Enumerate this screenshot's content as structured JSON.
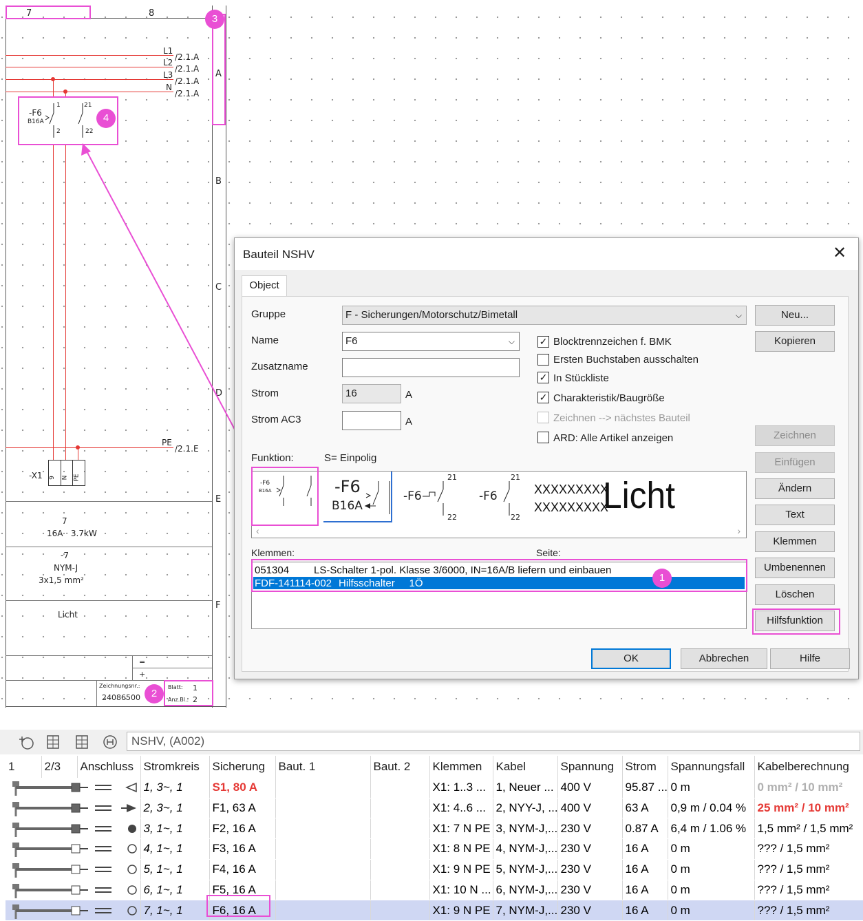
{
  "schematic": {
    "col_numbers": [
      "7",
      "8"
    ],
    "row_letters": [
      "A",
      "B",
      "C",
      "D",
      "E",
      "F"
    ],
    "phases": [
      {
        "name": "L1",
        "ref": "/2.1.A"
      },
      {
        "name": "L2",
        "ref": "/2.1.A"
      },
      {
        "name": "L3",
        "ref": "/2.1.A"
      },
      {
        "name": "N",
        "ref": "/2.1.A"
      }
    ],
    "pe": {
      "name": "PE",
      "ref": "/2.1.E"
    },
    "component": {
      "tag": "-F6",
      "rating": "B16A",
      "pins": [
        "1",
        "2"
      ],
      "aux_pins": [
        "21",
        "22"
      ]
    },
    "terminal": {
      "tag": "-X1",
      "cells": [
        "9",
        "N",
        "PE"
      ]
    },
    "info": {
      "circuit_no": "7",
      "power": "16A · 3.7kW",
      "cable_tag": "-7",
      "cable_type": "NYM-J",
      "cable_size": "3x1,5 mm²",
      "name": "Licht"
    },
    "titleblock": {
      "eq": "=",
      "plus": "+",
      "drawing_label": "Zeichnungsnr.:",
      "drawing_no": "24086500",
      "sheet_label": "Blatt:",
      "sheet_value": "1",
      "count_label": "Anz.Bl.:",
      "count_value": "2"
    }
  },
  "badges": [
    "1",
    "2",
    "3",
    "4"
  ],
  "dialog": {
    "title": "Bauteil NSHV",
    "tab": "Object",
    "gruppe_label": "Gruppe",
    "gruppe_value": "F - Sicherungen/Motorschutz/Bimetall",
    "name_label": "Name",
    "name_value": "F6",
    "zusatz_label": "Zusatzname",
    "zusatz_value": "",
    "strom_label": "Strom",
    "strom_value": "16",
    "strom_unit": "A",
    "stromac3_label": "Strom AC3",
    "stromac3_value": "",
    "stromac3_unit": "A",
    "checkboxes": [
      {
        "label": "Blocktrennzeichen f. BMK",
        "checked": true,
        "enabled": true
      },
      {
        "label": "Ersten Buchstaben ausschalten",
        "checked": false,
        "enabled": true
      },
      {
        "label": "In Stückliste",
        "checked": true,
        "enabled": true
      },
      {
        "label": "Charakteristik/Baugröße",
        "checked": true,
        "enabled": true
      },
      {
        "label": "Zeichnen --> nächstes Bauteil",
        "checked": false,
        "enabled": false
      },
      {
        "label": "ARD: Alle Artikel anzeigen",
        "checked": false,
        "enabled": true
      }
    ],
    "funktion_label": "Funktion:",
    "funktion_value": "S= Einpolig",
    "symbols": {
      "tag": "-F6",
      "rating": "B16A",
      "small_rating": "B16A",
      "pin_top": "21",
      "pin_bottom": "22",
      "placeholder": "XXXXXXXXX",
      "licht": "Licht"
    },
    "klemmen_label": "Klemmen:",
    "seite_label": "Seite:",
    "klemmen_rows": [
      {
        "code": "051304",
        "text": "LS-Schalter 1-pol. Klasse 3/6000, IN=16A/B liefern und einbauen",
        "selected": false
      },
      {
        "code": "FDF-141114-002",
        "text": "Hilfsschalter     1Ö",
        "selected": true
      }
    ],
    "side_buttons": [
      {
        "label": "Neu...",
        "enabled": true
      },
      {
        "label": "Kopieren",
        "enabled": true
      },
      {
        "label": "Zeichnen",
        "enabled": false
      },
      {
        "label": "Einfügen",
        "enabled": false
      },
      {
        "label": "Ändern",
        "enabled": true
      },
      {
        "label": "Text",
        "enabled": true
      },
      {
        "label": "Klemmen",
        "enabled": true
      },
      {
        "label": "Umbenennen",
        "enabled": true
      },
      {
        "label": "Löschen",
        "enabled": true
      },
      {
        "label": "Hilfsfunktion",
        "enabled": true
      }
    ],
    "ok_label": "OK",
    "cancel_label": "Abbrechen",
    "help_label": "Hilfe"
  },
  "toolbar": {
    "icons": [
      "add-circuit-icon",
      "table-add-icon",
      "table-edit-icon",
      "network-icon"
    ],
    "path": "NSHV,  (A002)"
  },
  "table": {
    "columns": [
      "1",
      "2/3",
      "Anschluss",
      "Stromkreis",
      "Sicherung",
      "Baut. 1",
      "Baut. 2",
      "Klemmen",
      "Kabel",
      "Spannung",
      "Strom",
      "Spannungsfall",
      "Kabelberechnung"
    ],
    "rows": [
      {
        "stromkreis": "1, 3~, 1",
        "sicherung": "S1, 80 A",
        "sich_red": true,
        "klemmen": "X1: 1..3 ...",
        "kabel": "1, Neuer ...",
        "spannung": "400 V",
        "strom": "95.87 ...",
        "fall": "0 m",
        "calc": "0 mm² / 10 mm²",
        "calc_style": "gray",
        "symbol": "open-triangle"
      },
      {
        "stromkreis": "2, 3~, 1",
        "sicherung": "F1, 63 A",
        "sich_red": false,
        "klemmen": "X1: 4..6 ...",
        "kabel": "2, NYY-J, ...",
        "spannung": "400 V",
        "strom": "63 A",
        "fall": "0,9 m / 0.04 %",
        "calc": "25 mm² / 10 mm²",
        "calc_style": "red",
        "symbol": "filled-arrow"
      },
      {
        "stromkreis": "3, 1~, 1",
        "sicherung": "F2, 16 A",
        "sich_red": false,
        "klemmen": "X1: 7 N PE",
        "kabel": "3, NYM-J,...",
        "spannung": "230 V",
        "strom": "0.87 A",
        "fall": "6,4 m / 1.06 %",
        "calc": "1,5 mm² / 1,5 mm²",
        "calc_style": "normal",
        "symbol": "filled-lamp"
      },
      {
        "stromkreis": "4, 1~, 1",
        "sicherung": "F3, 16 A",
        "sich_red": false,
        "klemmen": "X1: 8 N PE",
        "kabel": "4, NYM-J,...",
        "spannung": "230 V",
        "strom": "16 A",
        "fall": "0 m",
        "calc": "??? / 1,5 mm²",
        "calc_style": "normal",
        "symbol": "open-lamp"
      },
      {
        "stromkreis": "5, 1~, 1",
        "sicherung": "F4, 16 A",
        "sich_red": false,
        "klemmen": "X1: 9 N PE",
        "kabel": "5, NYM-J,...",
        "spannung": "230 V",
        "strom": "16 A",
        "fall": "0 m",
        "calc": "??? / 1,5 mm²",
        "calc_style": "normal",
        "symbol": "open-lamp"
      },
      {
        "stromkreis": "6, 1~, 1",
        "sicherung": "F5, 16 A",
        "sich_red": false,
        "klemmen": "X1: 10 N ...",
        "kabel": "6, NYM-J,...",
        "spannung": "230 V",
        "strom": "16 A",
        "fall": "0 m",
        "calc": "??? / 1,5 mm²",
        "calc_style": "normal",
        "symbol": "open-lamp"
      },
      {
        "stromkreis": "7, 1~, 1",
        "sicherung": "F6, 16 A",
        "sich_red": false,
        "klemmen": "X1: 9 N PE",
        "kabel": "7, NYM-J,...",
        "spannung": "230 V",
        "strom": "16 A",
        "fall": "0 m",
        "calc": "??? / 1,5 mm²",
        "calc_style": "normal",
        "symbol": "open-lamp",
        "selected": true
      }
    ]
  },
  "colors": {
    "highlight": "#e94fd4",
    "wire": "#e53935",
    "selection": "#0078d7",
    "table_selection": "#cfd7f3"
  }
}
